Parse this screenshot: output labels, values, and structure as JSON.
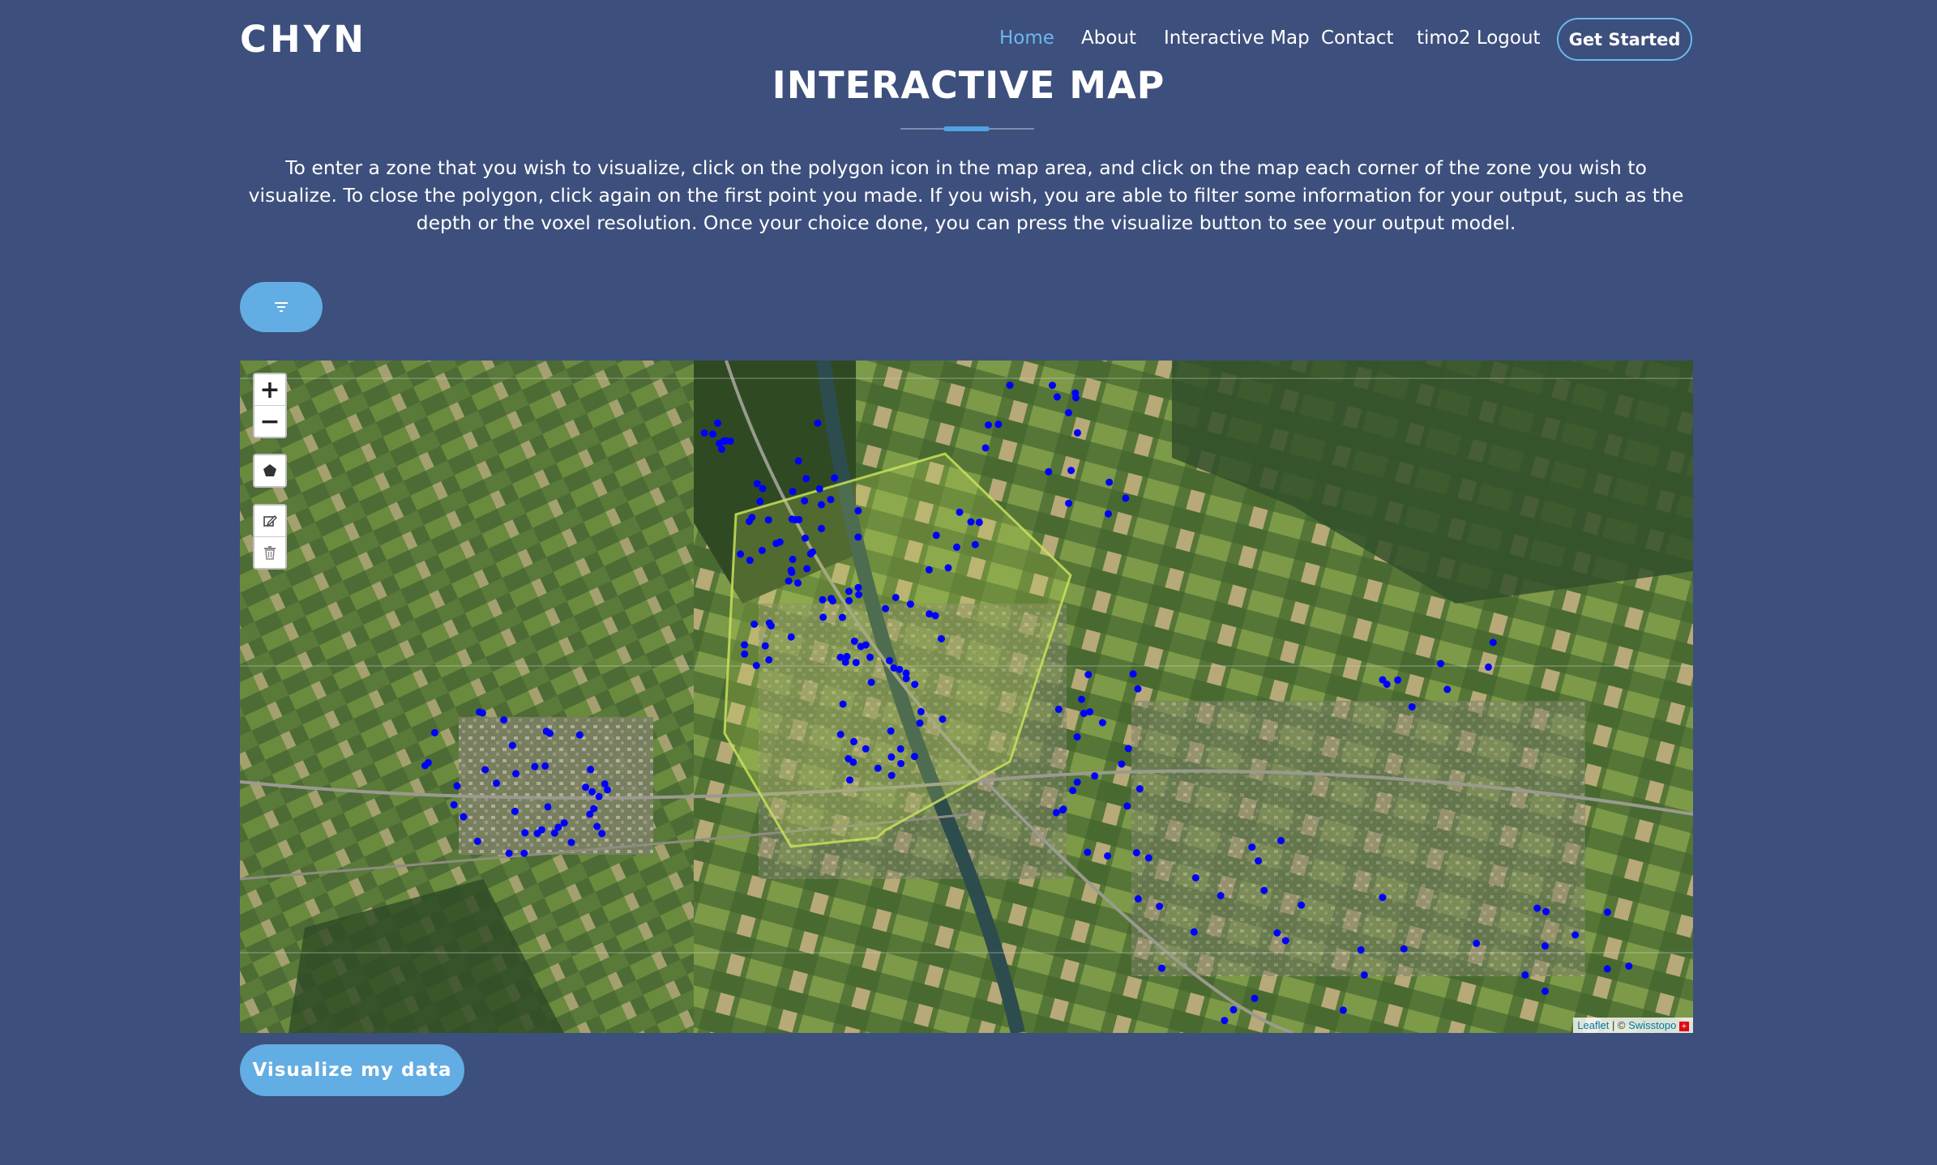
{
  "header": {
    "logo": "CHYN",
    "nav": [
      {
        "label": "Home",
        "active": true
      },
      {
        "label": "About",
        "active": false
      },
      {
        "label": "Interactive Map",
        "active": false
      },
      {
        "label": "Contact",
        "active": false
      },
      {
        "label": "timo2 Logout",
        "active": false
      }
    ],
    "cta_label": "Get Started"
  },
  "main": {
    "title": "INTERACTIVE MAP",
    "description": "To enter a zone that you wish to visualize, click on the polygon icon in the map area, and click on the map each corner of the zone you wish to visualize. To close the polygon, click again on the first point you made. If you wish, you are able to filter some information for your output, such as the depth or the voxel resolution. Once your choice done, you can press the visualize button to see your output model.",
    "filter_icon": "filter-icon",
    "visualize_label": "Visualize my data"
  },
  "map": {
    "controls": {
      "zoom_in": "+",
      "zoom_out": "−",
      "draw_polygon_icon": "pentagon-icon",
      "edit_icon": "edit-icon",
      "delete_icon": "trash-icon"
    },
    "attribution": {
      "leaflet": "Leaflet",
      "separator": " | © ",
      "provider": "Swisstopo"
    }
  },
  "colors": {
    "background": "#3d4f7c",
    "accent": "#62ade3",
    "nav_active": "#6bb8f0",
    "marker": "#0000ff",
    "polygon": "#c8e05a"
  }
}
